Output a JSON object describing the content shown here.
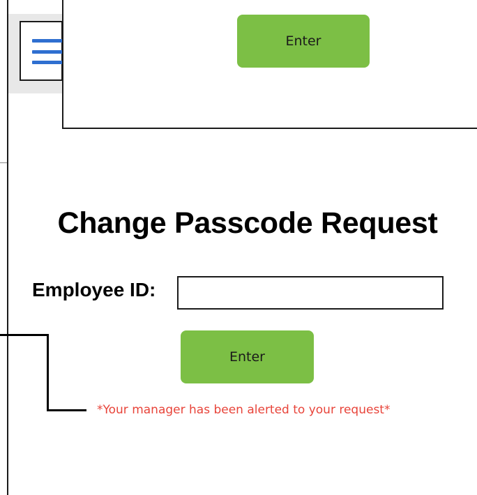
{
  "top_panel": {
    "enter_label": "Enter"
  },
  "menu": {
    "icon": "hamburger-menu-icon"
  },
  "form": {
    "title": "Change Passcode Request",
    "employee_id_label": "Employee ID:",
    "employee_id_value": "",
    "enter_label": "Enter",
    "alert_text": "*Your manager has been alerted to your request*"
  },
  "colors": {
    "button": "#7cbf45",
    "alert": "#e8443a",
    "menu_icon": "#2f6fd0"
  }
}
